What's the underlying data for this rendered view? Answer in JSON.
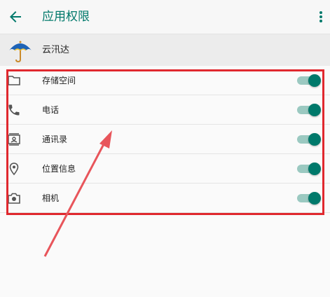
{
  "appbar": {
    "title": "应用权限",
    "back_icon": "arrow-left-icon",
    "more_icon": "more-vertical-icon"
  },
  "app": {
    "name": "云汛达",
    "icon": "umbrella-icon"
  },
  "permissions": [
    {
      "label": "存储空间",
      "icon": "folder-icon",
      "enabled": true
    },
    {
      "label": "电话",
      "icon": "phone-icon",
      "enabled": true
    },
    {
      "label": "通讯录",
      "icon": "contacts-icon",
      "enabled": true
    },
    {
      "label": "位置信息",
      "icon": "location-icon",
      "enabled": true
    },
    {
      "label": "相机",
      "icon": "camera-icon",
      "enabled": true
    }
  ],
  "colors": {
    "accent": "#00796b",
    "toggle_track": "#9bc9c1",
    "annotation": "#e0282e"
  }
}
